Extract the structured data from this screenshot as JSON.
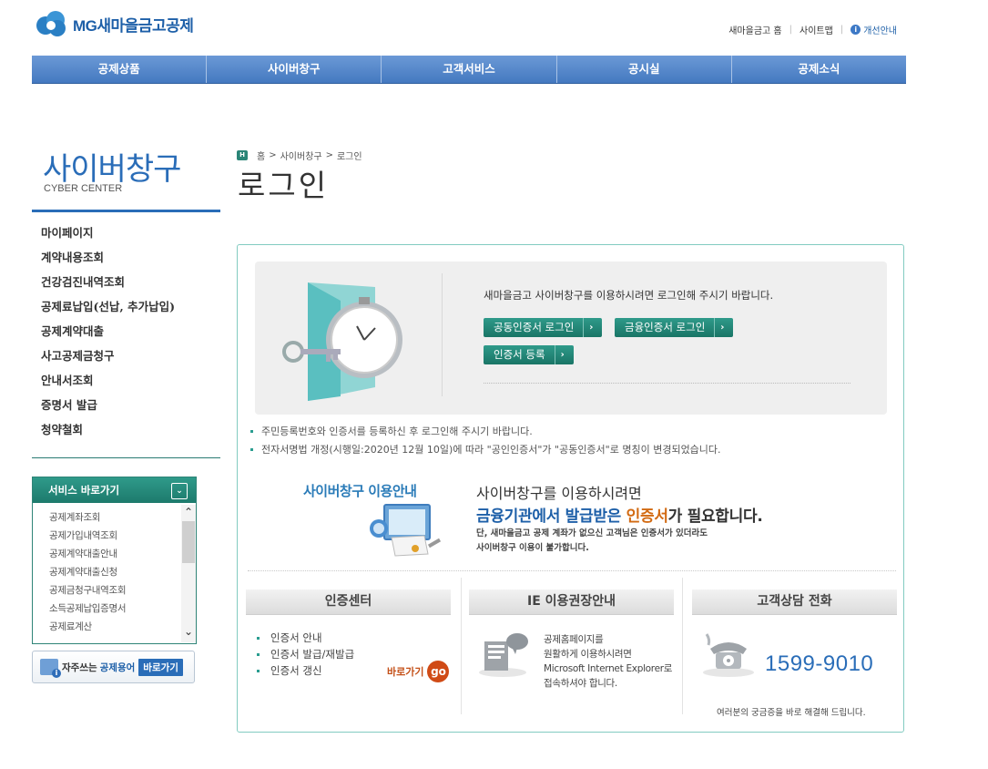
{
  "header": {
    "logo_text": "MG새마을금고공제",
    "utility": [
      "새마을금고 홈",
      "사이트맵",
      "개선안내"
    ],
    "info_glyph": "i"
  },
  "gnb": [
    "공제상품",
    "사이버창구",
    "고객서비스",
    "공시실",
    "공제소식"
  ],
  "sidebar": {
    "title": "사이버창구",
    "subtitle": "CYBER CENTER",
    "menu": [
      "마이페이지",
      "계약내용조회",
      "건강검진내역조회",
      "공제료납입(선납, 추가납입)",
      "공제계약대출",
      "사고공제금청구",
      "안내서조회",
      "증명서 발급",
      "청약철회"
    ],
    "service_box": {
      "title": "서비스 바로가기",
      "items": [
        "공제계좌조회",
        "공제가입내역조회",
        "공제계약대출안내",
        "공제계약대출신청",
        "공제금청구내역조회",
        "소득공제납입증명서",
        "공제료계산"
      ]
    },
    "term_button": {
      "prefix": "자주쓰는",
      "term": "공제용어",
      "go": "바로가기"
    }
  },
  "breadcrumb": [
    "홈",
    "사이버창구",
    "로그인"
  ],
  "page_title": "로그인",
  "login": {
    "message": "새마을금고 사이버창구를 이용하시려면 로그인해 주시기 바랍니다.",
    "buttons": [
      "공동인증서 로그인",
      "금융인증서 로그인",
      "인증서 등록"
    ]
  },
  "notes": [
    "주민등록번호와 인증서를 등록하신 후 로그인해 주시기 바랍니다.",
    "전자서명법 개정(시행일:2020년 12월 10일)에 따라 \"공인인증서\"가 \"공동인증서\"로 명칭이 변경되었습니다."
  ],
  "guide": {
    "title": "사이버창구 이용안내",
    "line1": "사이버창구를 이용하시려면",
    "line2_blue": "금융기관에서 발급받은 ",
    "line2_orange": "인증서",
    "line2_rest": "가 필요합니다.",
    "small1": "단, 새마을금고 공제 계좌가 없으신 고객님은 인증서가 있더라도",
    "small2": "사이버창구 이용이 불가합니다."
  },
  "cert_center": {
    "title": "인증센터",
    "items": [
      "인증서 안내",
      "인증서 발급/재발급",
      "인증서 갱신"
    ],
    "goto": "바로가기",
    "go": "go"
  },
  "ie_guide": {
    "title": "IE 이용권장안내",
    "lines": [
      "공제홈페이지를",
      "원활하게 이용하시려면",
      "Microsoft Internet Explorer로",
      "접속하셔야 합니다."
    ]
  },
  "contact": {
    "title": "고객상담 전화",
    "phone": "1599-9010",
    "note": "여러분의 궁금증을 바로 해결해 드립니다."
  },
  "colors": {
    "primary_blue": "#4479c0",
    "teal": "#1d7a6c",
    "orange": "#d04b16"
  }
}
